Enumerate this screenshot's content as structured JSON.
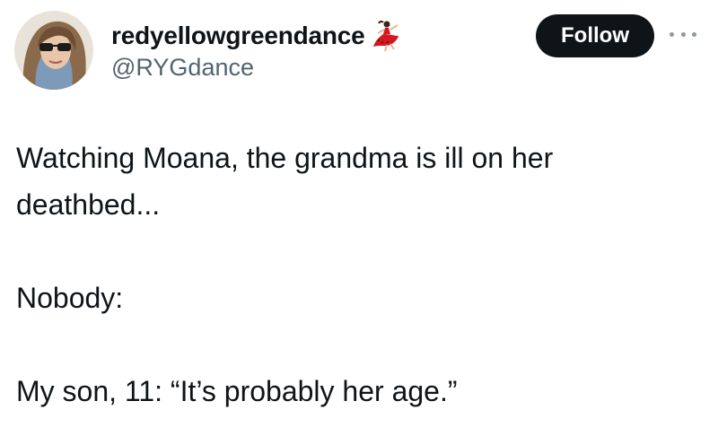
{
  "tweet": {
    "author": {
      "display_name": "redyellowgreendance",
      "handle": "@RYGdance",
      "name_emoji": "dancer-emoji",
      "avatar": "avatar-photo"
    },
    "follow_label": "Follow",
    "more_icon": "more-options-icon",
    "text": {
      "line1": "Watching Moana, the grandma is ill on her deathbed...",
      "line2": "Nobody:",
      "line3": "My son, 11: “It’s probably her age.”"
    }
  },
  "colors": {
    "text": "#0f1419",
    "secondary": "#536471",
    "button_bg": "#0f1419",
    "button_text": "#ffffff",
    "icon_grey": "#8b98a5"
  }
}
